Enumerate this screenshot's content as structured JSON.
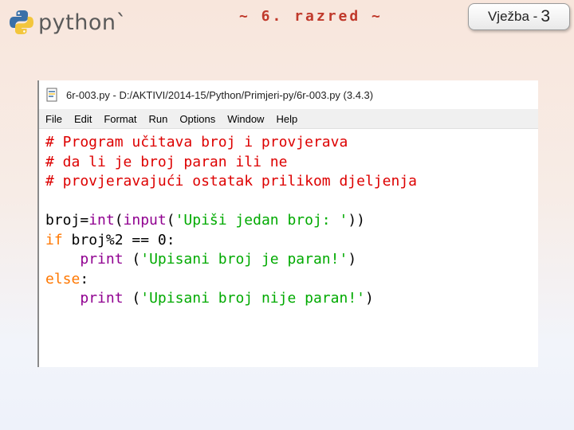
{
  "header": {
    "logo_text": "python",
    "logo_mark": "`",
    "slide_title": "~ 6. razred ~",
    "badge_label": "Vježba -",
    "badge_number": "3"
  },
  "window": {
    "title": "6r-003.py - D:/AKTIVI/2014-15/Python/Primjeri-py/6r-003.py (3.4.3)",
    "menu": [
      "File",
      "Edit",
      "Format",
      "Run",
      "Options",
      "Window",
      "Help"
    ]
  },
  "code": {
    "comment1": "# Program učitava broj i provjerava",
    "comment2": "# da li je broj paran ili ne",
    "comment3": "# provjeravajući ostatak prilikom djeljenja",
    "l5_a": "broj=",
    "l5_int": "int",
    "l5_b": "(",
    "l5_input": "input",
    "l5_c": "(",
    "l5_str": "'Upiši jedan broj: '",
    "l5_d": "))",
    "l6_if": "if",
    "l6_rest": " broj%2 == 0:",
    "l7_indent": "    ",
    "l7_print": "print",
    "l7_a": " (",
    "l7_str": "'Upisani broj je paran!'",
    "l7_b": ")",
    "l8_else": "else",
    "l8_colon": ":",
    "l9_indent": "    ",
    "l9_print": "print",
    "l9_a": " (",
    "l9_str": "'Upisani broj nije paran!'",
    "l9_b": ")"
  },
  "colors": {
    "comment": "#dd0000",
    "keyword": "#ff7700",
    "builtin": "#900090",
    "string": "#00aa00",
    "title": "#c0392b"
  }
}
